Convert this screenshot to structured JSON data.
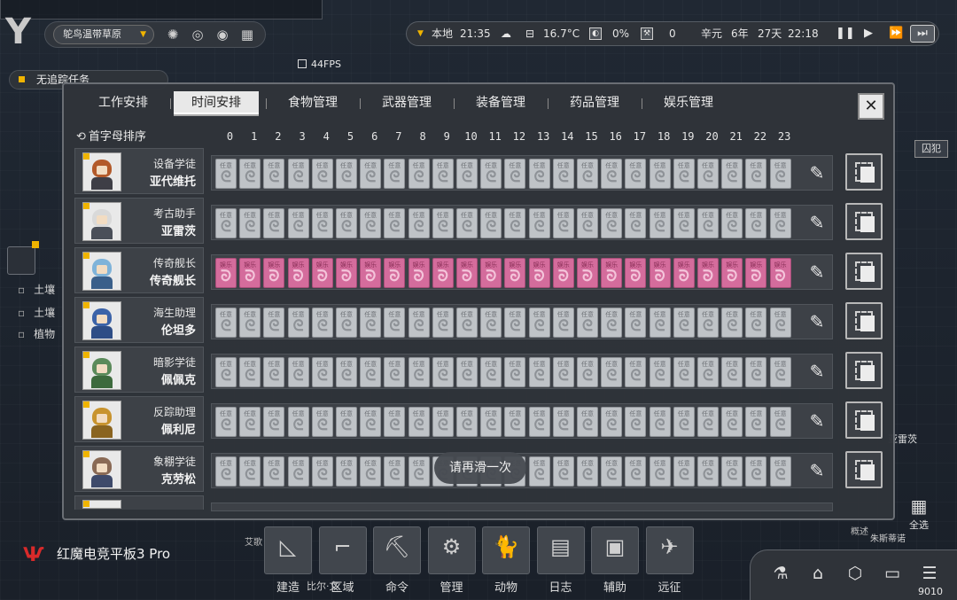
{
  "hud": {
    "biome": "鸵鸟温带草原",
    "tracking": "无追踪任务",
    "fps": "44FPS",
    "location": "本地",
    "clock": "21:35",
    "temperature": "16.7°C",
    "percent": "0%",
    "counter": "0",
    "date_year_label": "辛元",
    "date_year": "6年",
    "date_day": "27天",
    "date_time": "22:18",
    "prisoner_button": "囚犯"
  },
  "tabs": [
    {
      "label": "工作安排",
      "active": false
    },
    {
      "label": "时间安排",
      "active": true
    },
    {
      "label": "食物管理",
      "active": false
    },
    {
      "label": "武器管理",
      "active": false
    },
    {
      "label": "装备管理",
      "active": false
    },
    {
      "label": "药品管理",
      "active": false
    },
    {
      "label": "娱乐管理",
      "active": false
    }
  ],
  "sort_label": "首字母排序",
  "hours": [
    "0",
    "1",
    "2",
    "3",
    "4",
    "5",
    "6",
    "7",
    "8",
    "9",
    "10",
    "11",
    "12",
    "13",
    "14",
    "15",
    "16",
    "17",
    "18",
    "19",
    "20",
    "21",
    "22",
    "23"
  ],
  "labels": {
    "task": "任意",
    "fun": "娱乐"
  },
  "characters": [
    {
      "title": "设备学徒",
      "name": "亚代维托",
      "schedule": "task",
      "hair": "#b35a2a",
      "outfit": "#3e3e46"
    },
    {
      "title": "考古助手",
      "name": "亚雷茨",
      "schedule": "task",
      "hair": "#d9d9d9",
      "outfit": "#4a4f59"
    },
    {
      "title": "传奇舰长",
      "name": "传奇舰长",
      "schedule": "fun",
      "hair": "#7fb3d9",
      "outfit": "#3a5f8a"
    },
    {
      "title": "海生助理",
      "name": "伦坦多",
      "schedule": "task",
      "hair": "#3c63a8",
      "outfit": "#2e4d86"
    },
    {
      "title": "暗影学徒",
      "name": "佩佩克",
      "schedule": "task",
      "hair": "#5b8a5a",
      "outfit": "#3d6a3d"
    },
    {
      "title": "反踪助理",
      "name": "佩利尼",
      "schedule": "task",
      "hair": "#c8932e",
      "outfit": "#8a6420"
    },
    {
      "title": "象棚学徒",
      "name": "克劳松",
      "schedule": "task",
      "hair": "#8a6a55",
      "outfit": "#3e4a6a"
    }
  ],
  "toast": "请再滑一次",
  "side_items": [
    "土壤",
    "土壤",
    "植物"
  ],
  "bg_labels": {
    "name_right": "亚雷茨",
    "name_bottom": "朱斯蒂诺",
    "left_bottom": "艾歌",
    "near_tray": "概述"
  },
  "brand": "红魔电竞平板3 Pro",
  "dock": [
    {
      "label": "建造",
      "icon": "build-icon",
      "glyph": "◺"
    },
    {
      "label": "区域",
      "icon": "zone-icon",
      "glyph": "⌐"
    },
    {
      "label": "命令",
      "icon": "command-icon",
      "glyph": "⛏"
    },
    {
      "label": "管理",
      "icon": "manage-icon",
      "glyph": "⚙"
    },
    {
      "label": "动物",
      "icon": "animal-icon",
      "glyph": "🐈"
    },
    {
      "label": "日志",
      "icon": "log-icon",
      "glyph": "▤"
    },
    {
      "label": "辅助",
      "icon": "assist-icon",
      "glyph": "▣"
    },
    {
      "label": "远征",
      "icon": "expedition-icon",
      "glyph": "✈"
    }
  ],
  "dock_sub": "比尔·文",
  "select_all": "全选",
  "tray_number": "9010"
}
